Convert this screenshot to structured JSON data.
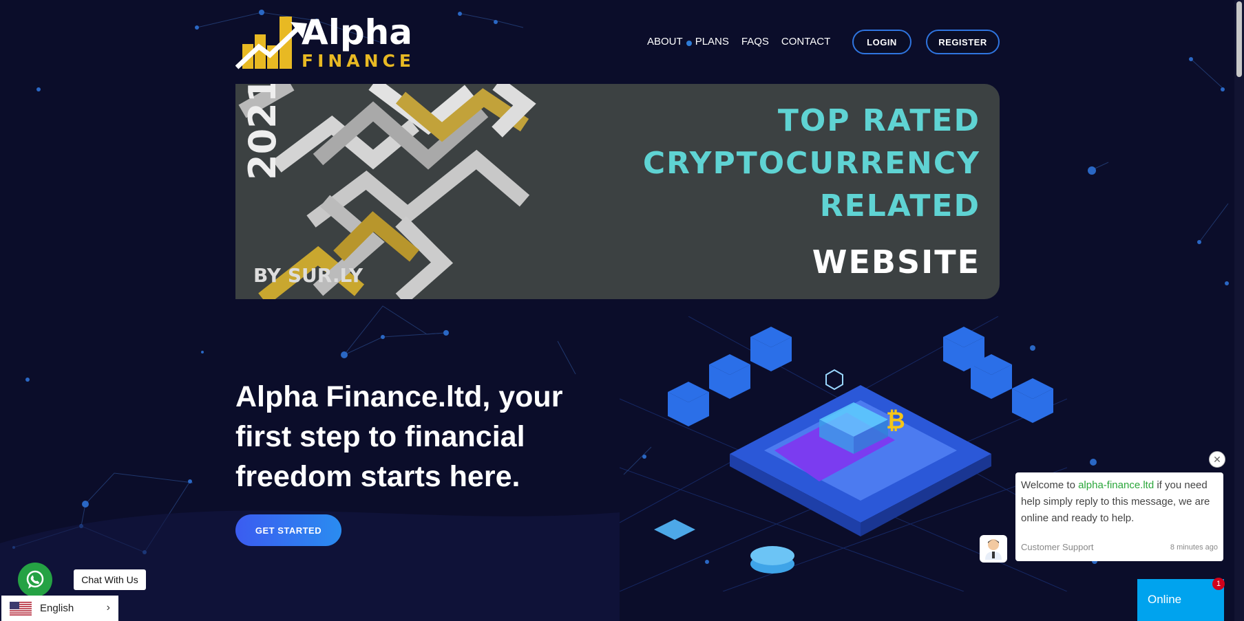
{
  "brand": {
    "name_main": "Alpha",
    "name_sub": "FINANCE",
    "accent_color": "#e8b923"
  },
  "nav": {
    "items": [
      "ABOUT",
      "PLANS",
      "FAQS",
      "CONTACT"
    ],
    "login_label": "LOGIN",
    "register_label": "REGISTER"
  },
  "banner": {
    "year": "2021",
    "by": "BY SUR.LY",
    "line1": "TOP RATED",
    "line2": "CRYPTOCURRENCY",
    "line3": "RELATED",
    "line4": "WEBSITE"
  },
  "hero": {
    "title": "Alpha Finance.ltd, your first step to financial freedom starts here.",
    "cta_label": "GET STARTED"
  },
  "chat": {
    "message_prefix": "Welcome to ",
    "message_link": "alpha-finance.ltd",
    "message_suffix": " if you need help simply reply to this message, we are online and ready to help.",
    "agent": "Customer Support",
    "time": "8 minutes ago",
    "online_label": "Online",
    "unread_count": "1",
    "close_glyph": "✕"
  },
  "whatsapp": {
    "label": "Chat With Us"
  },
  "language": {
    "selected": "English",
    "chevron": "›"
  }
}
